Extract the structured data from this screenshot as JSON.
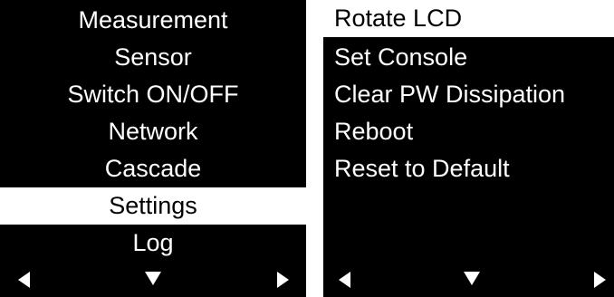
{
  "left_screen": {
    "menu_items": [
      {
        "label": "Measurement",
        "selected": false
      },
      {
        "label": "Sensor",
        "selected": false
      },
      {
        "label": "Switch ON/OFF",
        "selected": false
      },
      {
        "label": "Network",
        "selected": false
      },
      {
        "label": "Cascade",
        "selected": false
      },
      {
        "label": "Settings",
        "selected": true
      },
      {
        "label": "Log",
        "selected": false
      }
    ],
    "nav": {
      "left_icon": "arrow-left-icon",
      "down_icon": "arrow-down-icon",
      "right_icon": "arrow-right-icon"
    }
  },
  "right_screen": {
    "menu_items": [
      {
        "label": "Rotate LCD",
        "selected": true
      },
      {
        "label": "Set Console",
        "selected": false
      },
      {
        "label": "Clear PW Dissipation",
        "selected": false
      },
      {
        "label": "Reboot",
        "selected": false
      },
      {
        "label": "Reset to Default",
        "selected": false
      }
    ],
    "nav": {
      "left_icon": "arrow-left-icon",
      "down_icon": "arrow-down-icon",
      "right_icon": "arrow-right-icon"
    }
  },
  "colors": {
    "screen_background": "#000000",
    "text": "#ffffff",
    "selected_background": "#ffffff",
    "selected_text": "#000000"
  }
}
